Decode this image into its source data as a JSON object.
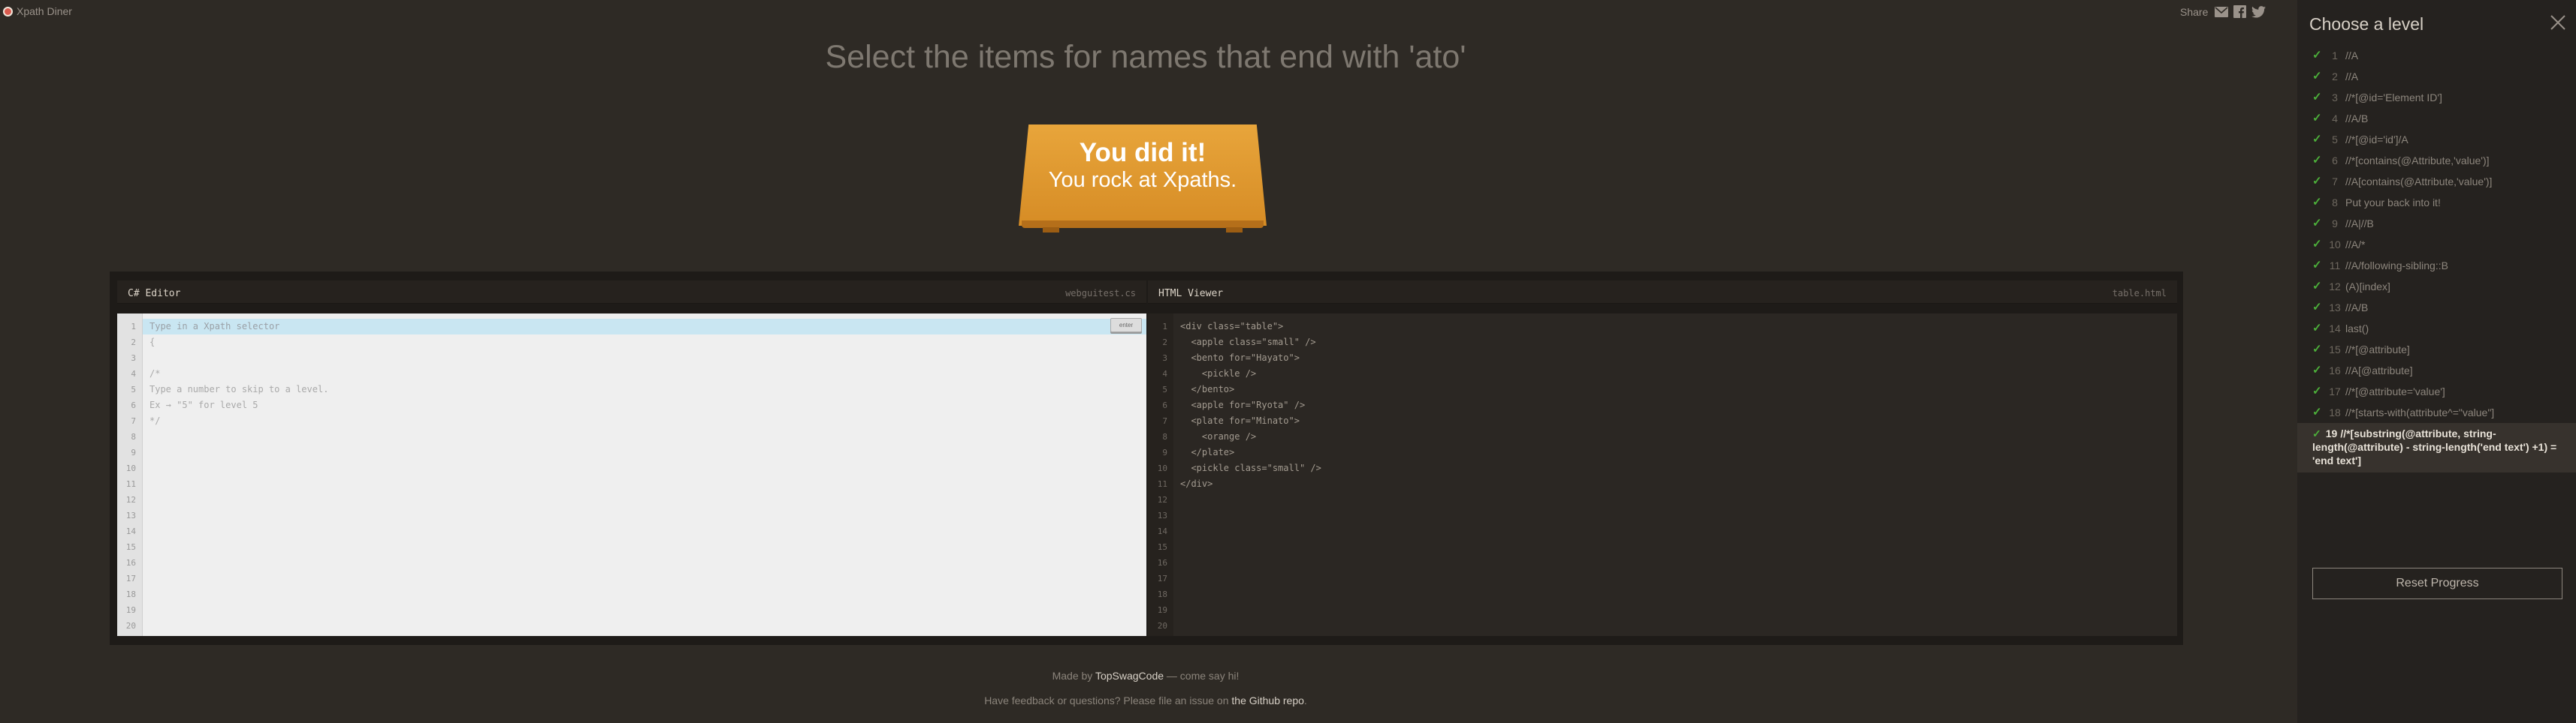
{
  "brand": {
    "name": "Xpath Diner"
  },
  "share": {
    "label": "Share",
    "icons": [
      "mail-icon",
      "facebook-icon",
      "twitter-icon"
    ]
  },
  "heading": "Select the items for names that end with 'ato'",
  "success": {
    "title": "You did it!",
    "subtitle": "You rock at Xpaths."
  },
  "editor": {
    "title": "C# Editor",
    "file": "webguitest.cs",
    "placeholder": "Type in a Xpath selector",
    "enter_label": "enter",
    "lines": [
      "Type in a Xpath selector",
      "{",
      "",
      "/*",
      "Type a number to skip to a level.",
      "Ex → \"5\" for level 5",
      "*/",
      "",
      "",
      "",
      "",
      "",
      "",
      "",
      "",
      "",
      "",
      "",
      "",
      ""
    ],
    "line_numbers": [
      "1",
      "2",
      "3",
      "4",
      "5",
      "6",
      "7",
      "8",
      "9",
      "10",
      "11",
      "12",
      "13",
      "14",
      "15",
      "16",
      "17",
      "18",
      "19",
      "20"
    ]
  },
  "viewer": {
    "title": "HTML Viewer",
    "file": "table.html",
    "lines": [
      "<div class=\"table\">",
      "  <apple class=\"small\" />",
      "  <bento for=\"Hayato\">",
      "    <pickle />",
      "  </bento>",
      "  <apple for=\"Ryota\" />",
      "  <plate for=\"Minato\">",
      "    <orange />",
      "  </plate>",
      "  <pickle class=\"small\" />",
      "</div>",
      "",
      "",
      "",
      "",
      "",
      "",
      "",
      "",
      ""
    ],
    "line_numbers": [
      "1",
      "2",
      "3",
      "4",
      "5",
      "6",
      "7",
      "8",
      "9",
      "10",
      "11",
      "12",
      "13",
      "14",
      "15",
      "16",
      "17",
      "18",
      "19",
      "20"
    ]
  },
  "footer": {
    "line1_prefix": "Made by ",
    "line1_link": "TopSwagCode",
    "line1_suffix": " — come say hi!",
    "line2_prefix": "Have feedback or questions? Please file an issue on ",
    "line2_link": "the Github repo",
    "line2_suffix": "."
  },
  "sidebar": {
    "title": "Choose a level",
    "levels": [
      {
        "num": "1",
        "label": "//A",
        "done": true
      },
      {
        "num": "2",
        "label": "//A",
        "done": true
      },
      {
        "num": "3",
        "label": "//*[@id='Element ID']",
        "done": true
      },
      {
        "num": "4",
        "label": "//A/B",
        "done": true
      },
      {
        "num": "5",
        "label": "//*[@id='id']/A",
        "done": true
      },
      {
        "num": "6",
        "label": "//*[contains(@Attribute,'value')]",
        "done": true
      },
      {
        "num": "7",
        "label": "//A[contains(@Attribute,'value')]",
        "done": true
      },
      {
        "num": "8",
        "label": "Put your back into it!",
        "done": true
      },
      {
        "num": "9",
        "label": "//A|//B",
        "done": true
      },
      {
        "num": "10",
        "label": "//A/*",
        "done": true
      },
      {
        "num": "11",
        "label": "//A/following-sibling::B",
        "done": true
      },
      {
        "num": "12",
        "label": "(A)[index]",
        "done": true
      },
      {
        "num": "13",
        "label": "//A/B",
        "done": true
      },
      {
        "num": "14",
        "label": "last()",
        "done": true
      },
      {
        "num": "15",
        "label": "//*[@attribute]",
        "done": true
      },
      {
        "num": "16",
        "label": "//A[@attribute]",
        "done": true
      },
      {
        "num": "17",
        "label": "//*[@attribute='value']",
        "done": true
      },
      {
        "num": "18",
        "label": "//*[starts-with(attribute^=\"value\"]",
        "done": true
      }
    ],
    "current": {
      "num": "19",
      "label": "//*[substring(@attribute, string-length(@attribute) - string-length('end text') +1) = 'end text']",
      "done": true
    },
    "reset_label": "Reset Progress"
  },
  "colors": {
    "accent": "#e39e35",
    "check": "#4caf3a",
    "background": "#2e2a25",
    "sidebar": "#25221f"
  }
}
